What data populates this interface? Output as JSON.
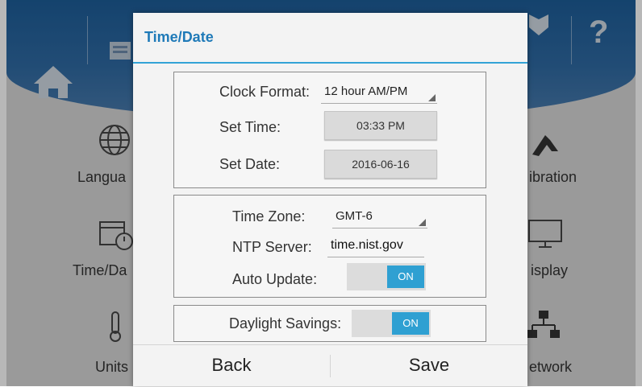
{
  "background": {
    "tiles": {
      "language_label": "Langua",
      "timedate_label": "Time/Da",
      "units_label": "Units",
      "calibration_label": "ibration",
      "display_label": "isplay",
      "network_label": "etwork"
    },
    "help_glyph": "?"
  },
  "dialog": {
    "title": "Time/Date",
    "clock_format": {
      "label": "Clock Format:",
      "value": "12 hour AM/PM"
    },
    "set_time": {
      "label": "Set Time:",
      "value": "03:33 PM"
    },
    "set_date": {
      "label": "Set Date:",
      "value": "2016-06-16"
    },
    "time_zone": {
      "label": "Time Zone:",
      "value": "GMT-6"
    },
    "ntp_server": {
      "label": "NTP Server:",
      "value": "time.nist.gov"
    },
    "auto_update": {
      "label": "Auto Update:",
      "state": "ON"
    },
    "daylight_savings": {
      "label": "Daylight Savings:",
      "state": "ON"
    },
    "back_label": "Back",
    "save_label": "Save"
  },
  "colors": {
    "accent": "#2fa0d2",
    "title": "#1f7ab8",
    "header": "#2f6aa3"
  }
}
